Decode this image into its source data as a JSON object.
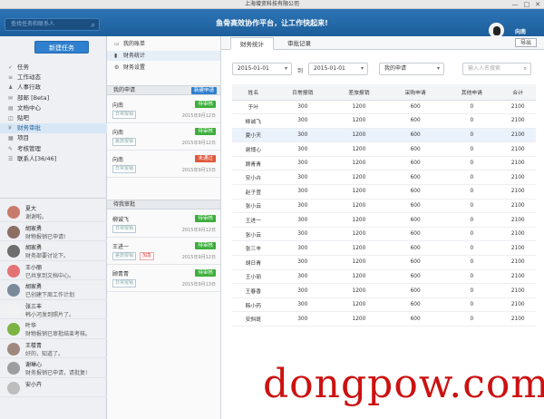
{
  "window": {
    "title": "上海增资科技有限公司",
    "controls": [
      "—",
      "□",
      "✕"
    ]
  },
  "header": {
    "search_placeholder": "查找任务和联系人",
    "slogan": "鱼骨高效协作平台，让工作快起来!",
    "user": "向南"
  },
  "sidebar": {
    "new_task": "新建任务",
    "nav": [
      {
        "label": "任务",
        "icon": "check-icon"
      },
      {
        "label": "工作动态",
        "icon": "activity-icon"
      },
      {
        "label": "人事行政",
        "icon": "people-icon"
      },
      {
        "label": "部邮 [Beta]",
        "icon": "mail-icon"
      },
      {
        "label": "文档中心",
        "icon": "folder-icon"
      },
      {
        "label": "贴吧",
        "icon": "chat-icon"
      },
      {
        "label": "财务审批",
        "icon": "finance-icon",
        "active": true
      },
      {
        "label": "项目",
        "icon": "project-icon"
      },
      {
        "label": "考核管理",
        "icon": "assess-icon"
      },
      {
        "label": "联系人[36/46]",
        "icon": "contacts-icon"
      }
    ],
    "contacts": [
      {
        "name": "夏大",
        "msg": "谢谢啦。",
        "color": "#c97b6b"
      },
      {
        "name": "胡家勇",
        "msg": "财物报销已申请!",
        "color": "#8d6e63"
      },
      {
        "name": "胡家勇",
        "msg": "财务部要讨论下。",
        "color": "#6d6d6d"
      },
      {
        "name": "王小丽",
        "msg": "已共享到文档中心。",
        "color": "#e57373"
      },
      {
        "name": "胡家勇",
        "msg": "已创建下周工作计划",
        "color": "#7b8a9a"
      },
      {
        "name": "张三丰",
        "msg": "韩小河发到照片了。",
        "color": "#f2f2f2"
      },
      {
        "name": "叶华",
        "msg": "财物报销已审批结束考核。",
        "color": "#7cb342"
      },
      {
        "name": "王楼青",
        "msg": "好的，知道了。",
        "color": "#a1887f"
      },
      {
        "name": "谢琳心",
        "msg": "财务报销已申请，请批复!",
        "color": "#9e9e9e"
      },
      {
        "name": "安小卉",
        "msg": "",
        "color": "#bdbdbd"
      }
    ]
  },
  "middle": {
    "tabs": [
      {
        "label": "我的账单",
        "icon": "list-icon"
      },
      {
        "label": "财务统计",
        "icon": "chart-icon",
        "selected": true
      },
      {
        "label": "财务设置",
        "icon": "settings-icon"
      }
    ],
    "my_requests_label": "我的申请",
    "new_request": "新建申请",
    "my_requests": [
      {
        "name": "向南",
        "tag": "日常报销",
        "status": "待审核",
        "status_color": "#3cae3c",
        "date": "2015年9月12日"
      },
      {
        "name": "向南",
        "tag": "差旅报销",
        "status": "待审核",
        "status_color": "#3cae3c",
        "date": "2015年9月12日"
      },
      {
        "name": "向南",
        "tag": "日常报销",
        "status": "未通过",
        "status_color": "#e0583b",
        "date": "2015年9月13日"
      }
    ],
    "pending_label": "待我审批",
    "pending": [
      {
        "name": "柳诚飞",
        "tag": "日常报销",
        "tag2": "",
        "status": "待审核",
        "status_color": "#3cae3c",
        "date": "2015年9月12日"
      },
      {
        "name": "王进一",
        "tag": "差旅报销",
        "tag2": "加急",
        "status": "待审核",
        "status_color": "#3cae3c",
        "date": "2015年9月12日"
      },
      {
        "name": "顾青青",
        "tag": "日常报销",
        "tag2": "",
        "status": "待审核",
        "status_color": "#3cae3c",
        "date": "2015年9月13日"
      }
    ]
  },
  "main": {
    "tabs": [
      "财务统计",
      "审批记录"
    ],
    "export": "导出",
    "date_from": "2015-01-01",
    "to_label": "到",
    "date_to": "2015-01-01",
    "type_select": "我的申请",
    "name_search_placeholder": "输入人名搜索",
    "columns": [
      "姓名",
      "日常报销",
      "差旅报销",
      "采购申请",
      "其他申请",
      "合计"
    ],
    "rows": [
      [
        "于叶",
        "300",
        "1200",
        "600",
        "0",
        "2100"
      ],
      [
        "柳诚飞",
        "300",
        "1200",
        "600",
        "0",
        "2100"
      ],
      [
        "夏小天",
        "300",
        "1200",
        "600",
        "0",
        "2100"
      ],
      [
        "谢博心",
        "300",
        "1200",
        "600",
        "0",
        "2100"
      ],
      [
        "顾青青",
        "300",
        "1200",
        "600",
        "0",
        "2100"
      ],
      [
        "安小卉",
        "300",
        "1200",
        "600",
        "0",
        "2100"
      ],
      [
        "赵子萱",
        "300",
        "1200",
        "600",
        "0",
        "2100"
      ],
      [
        "张小云",
        "300",
        "1200",
        "600",
        "0",
        "2100"
      ],
      [
        "王进一",
        "300",
        "1200",
        "600",
        "0",
        "2100"
      ],
      [
        "张小云",
        "300",
        "1200",
        "600",
        "0",
        "2100"
      ],
      [
        "张三丰",
        "300",
        "1200",
        "600",
        "0",
        "2100"
      ],
      [
        "胡日青",
        "300",
        "1200",
        "600",
        "0",
        "2100"
      ],
      [
        "王小丽",
        "300",
        "1200",
        "600",
        "0",
        "2100"
      ],
      [
        "王春香",
        "300",
        "1200",
        "600",
        "0",
        "2100"
      ],
      [
        "韩小药",
        "300",
        "1200",
        "600",
        "0",
        "2100"
      ],
      [
        "安斜斑",
        "300",
        "1200",
        "600",
        "0",
        "2100"
      ]
    ],
    "highlight_row": 2
  },
  "watermark": "dongpow.com"
}
